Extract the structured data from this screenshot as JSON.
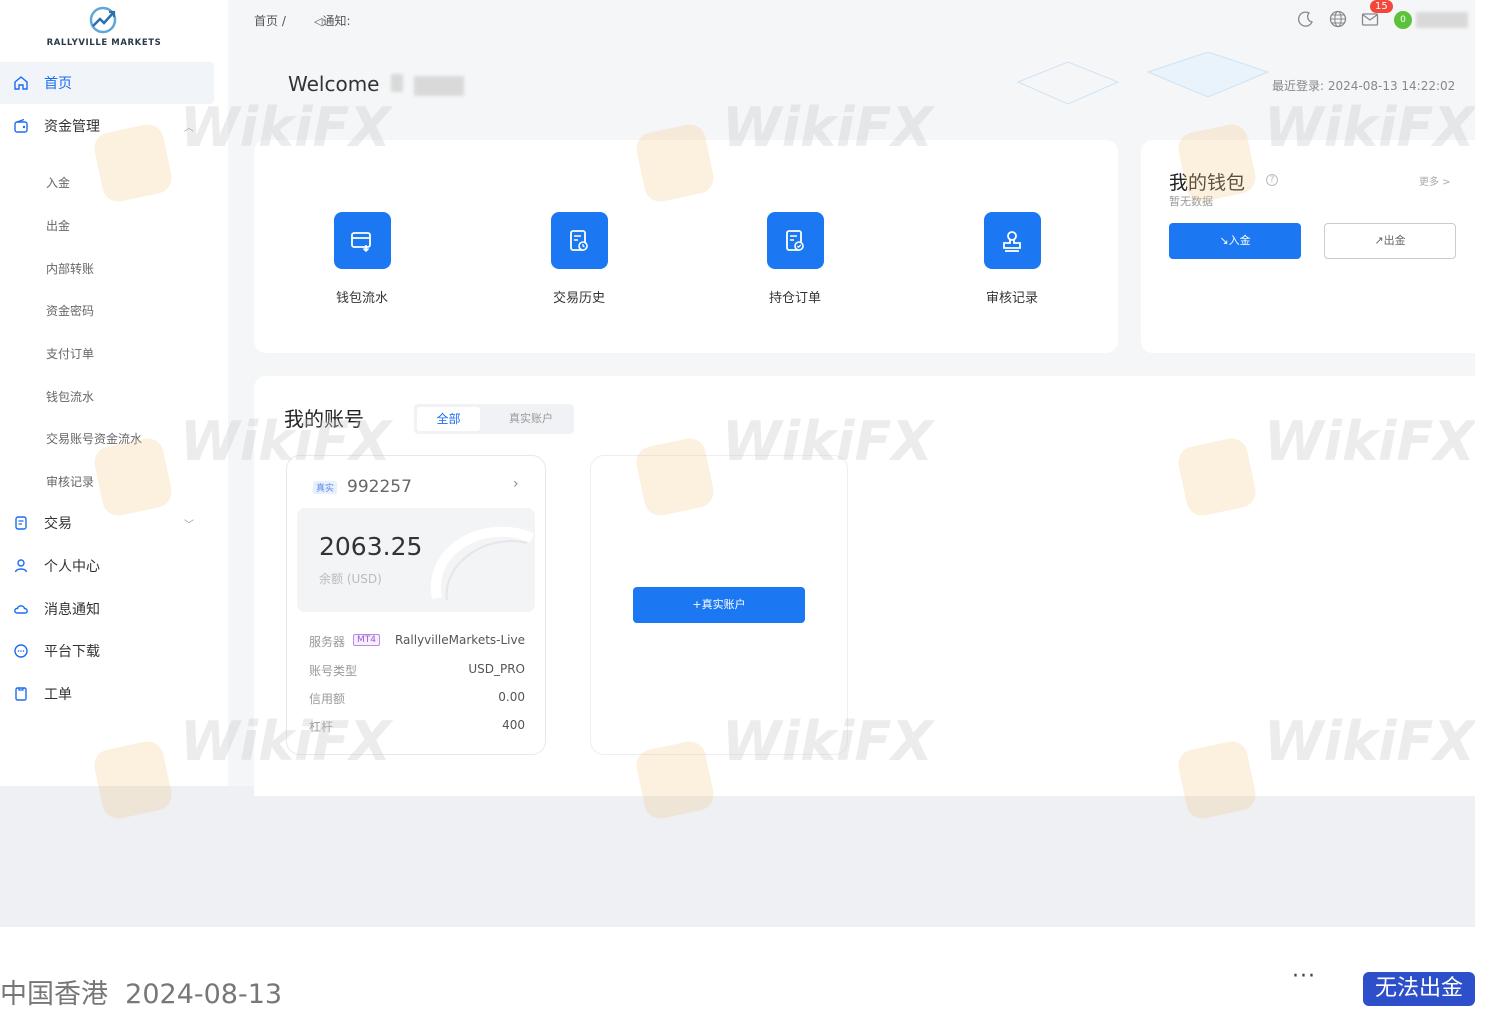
{
  "brand": {
    "name": "RALLYVILLE MARKETS"
  },
  "sidebar": {
    "items": [
      {
        "label": "首页",
        "icon": "home-icon",
        "active": true
      },
      {
        "label": "资金管理",
        "icon": "wallet-icon",
        "expanded": true
      },
      {
        "label": "交易",
        "icon": "trade-icon"
      },
      {
        "label": "个人中心",
        "icon": "user-icon"
      },
      {
        "label": "消息通知",
        "icon": "cloud-icon"
      },
      {
        "label": "平台下载",
        "icon": "download-icon"
      },
      {
        "label": "工单",
        "icon": "ticket-icon"
      }
    ],
    "sub_items": [
      "入金",
      "出金",
      "内部转账",
      "资金密码",
      "支付订单",
      "钱包流水",
      "交易账号资金流水",
      "审核记录"
    ]
  },
  "topbar": {
    "breadcrumb_home": "首页 /",
    "breadcrumb_notice": "通知:",
    "mail_count": "15",
    "avatar_initial": "0"
  },
  "welcome": {
    "text": "Welcome",
    "last_login_label": "最近登录: 2024-08-13 14:22:02"
  },
  "quick_links": [
    "钱包流水",
    "交易历史",
    "持仓订单",
    "审核记录"
  ],
  "wallet": {
    "title": "我的钱包",
    "empty": "暂无数据",
    "more": "更多 >",
    "deposit": "↘入金",
    "withdraw": "↗出金"
  },
  "accounts": {
    "title": "我的账号",
    "tab_all": "全部",
    "tab_real": "真实账户",
    "card": {
      "type_tag": "真实",
      "number": "992257",
      "balance": "2063.25",
      "balance_label": "余额 (USD)",
      "server_label": "服务器",
      "server_tag": "MT4",
      "server_value": "RallyvilleMarkets-Live",
      "acct_type_label": "账号类型",
      "acct_type_value": "USD_PRO",
      "credit_label": "信用额",
      "credit_value": "0.00",
      "leverage_label": "杠杆",
      "leverage_value": "400"
    },
    "add_real": "+真实账户"
  },
  "footer": {
    "location": "中国香港",
    "date": "2024-08-13",
    "more": "···",
    "badge": "无法出金"
  },
  "watermark": "WikiFX",
  "colors": {
    "primary": "#1b78f2",
    "badge": "#2d4fc9"
  }
}
